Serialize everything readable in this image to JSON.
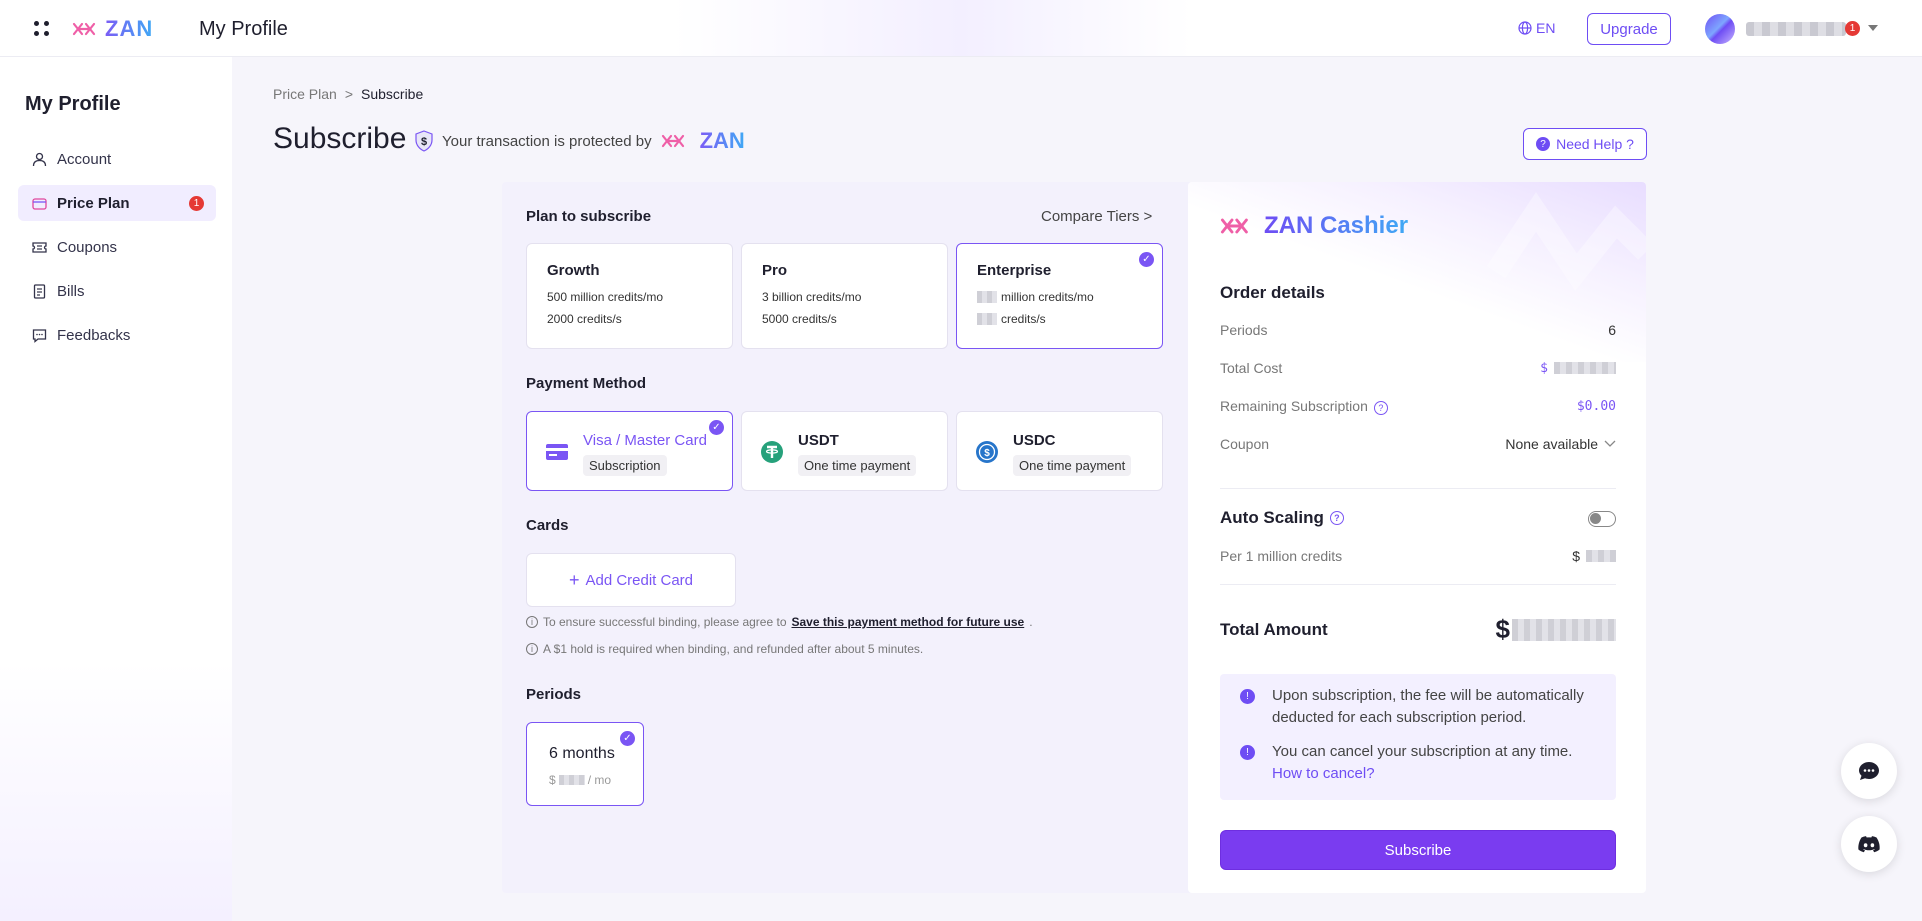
{
  "header": {
    "logo_text": "ZAN",
    "title": "My Profile",
    "language": "EN",
    "upgrade_label": "Upgrade",
    "notification_count": "1"
  },
  "sidebar": {
    "title": "My Profile",
    "items": [
      {
        "label": "Account",
        "icon": "user-icon"
      },
      {
        "label": "Price Plan",
        "icon": "wallet-icon",
        "badge": "1",
        "active": true
      },
      {
        "label": "Coupons",
        "icon": "ticket-icon"
      },
      {
        "label": "Bills",
        "icon": "document-icon"
      },
      {
        "label": "Feedbacks",
        "icon": "message-icon"
      }
    ]
  },
  "breadcrumb": {
    "parent": "Price Plan",
    "separator": ">",
    "current": "Subscribe"
  },
  "page": {
    "title": "Subscribe",
    "protected_text": "Your transaction is protected by",
    "protected_brand": "ZAN",
    "need_help": "Need Help ?"
  },
  "plan_section": {
    "title": "Plan to subscribe",
    "compare_link": "Compare Tiers >",
    "plans": [
      {
        "name": "Growth",
        "line1": "500 million credits/mo",
        "line2": "2000 credits/s",
        "selected": false
      },
      {
        "name": "Pro",
        "line1": "3 billion credits/mo",
        "line2": "5000 credits/s",
        "selected": false
      },
      {
        "name": "Enterprise",
        "line1": "million credits/mo",
        "line2": "credits/s",
        "selected": true
      }
    ]
  },
  "payment_section": {
    "title": "Payment Method",
    "methods": [
      {
        "name": "Visa / Master Card",
        "sub": "Subscription",
        "icon": "credit-card-icon",
        "selected": true
      },
      {
        "name": "USDT",
        "sub": "One time payment",
        "icon": "usdt-icon",
        "selected": false
      },
      {
        "name": "USDC",
        "sub": "One time payment",
        "icon": "usdc-icon",
        "selected": false
      }
    ]
  },
  "cards_section": {
    "title": "Cards",
    "add_label": "Add Credit Card",
    "note1_prefix": "To ensure successful binding, please agree to",
    "note1_link": "Save this payment method for future use",
    "note1_suffix": ".",
    "note2": "A $1 hold is required when binding, and refunded after about 5 minutes."
  },
  "periods_section": {
    "title": "Periods",
    "period_name": "6 months",
    "price_prefix": "$",
    "price_suffix": "/ mo"
  },
  "cashier": {
    "brand": "ZAN Cashier",
    "order_title": "Order details",
    "periods_label": "Periods",
    "periods_value": "6",
    "total_cost_label": "Total Cost",
    "total_cost_prefix": "$",
    "remaining_label": "Remaining Subscription",
    "remaining_value": "$0.00",
    "coupon_label": "Coupon",
    "coupon_value": "None available",
    "auto_scaling_label": "Auto Scaling",
    "auto_scaling_on": false,
    "per_million_label": "Per 1 million credits",
    "per_million_prefix": "$",
    "total_amount_label": "Total Amount",
    "total_amount_prefix": "$",
    "info1": "Upon subscription, the fee will be automatically deducted for each subscription period.",
    "info2": "You can cancel your subscription at any time.",
    "info2_link": "How to cancel?",
    "subscribe_label": "Subscribe"
  },
  "colors": {
    "accent": "#7a55f4",
    "button": "#7a3cf0",
    "badge": "#e53935"
  }
}
